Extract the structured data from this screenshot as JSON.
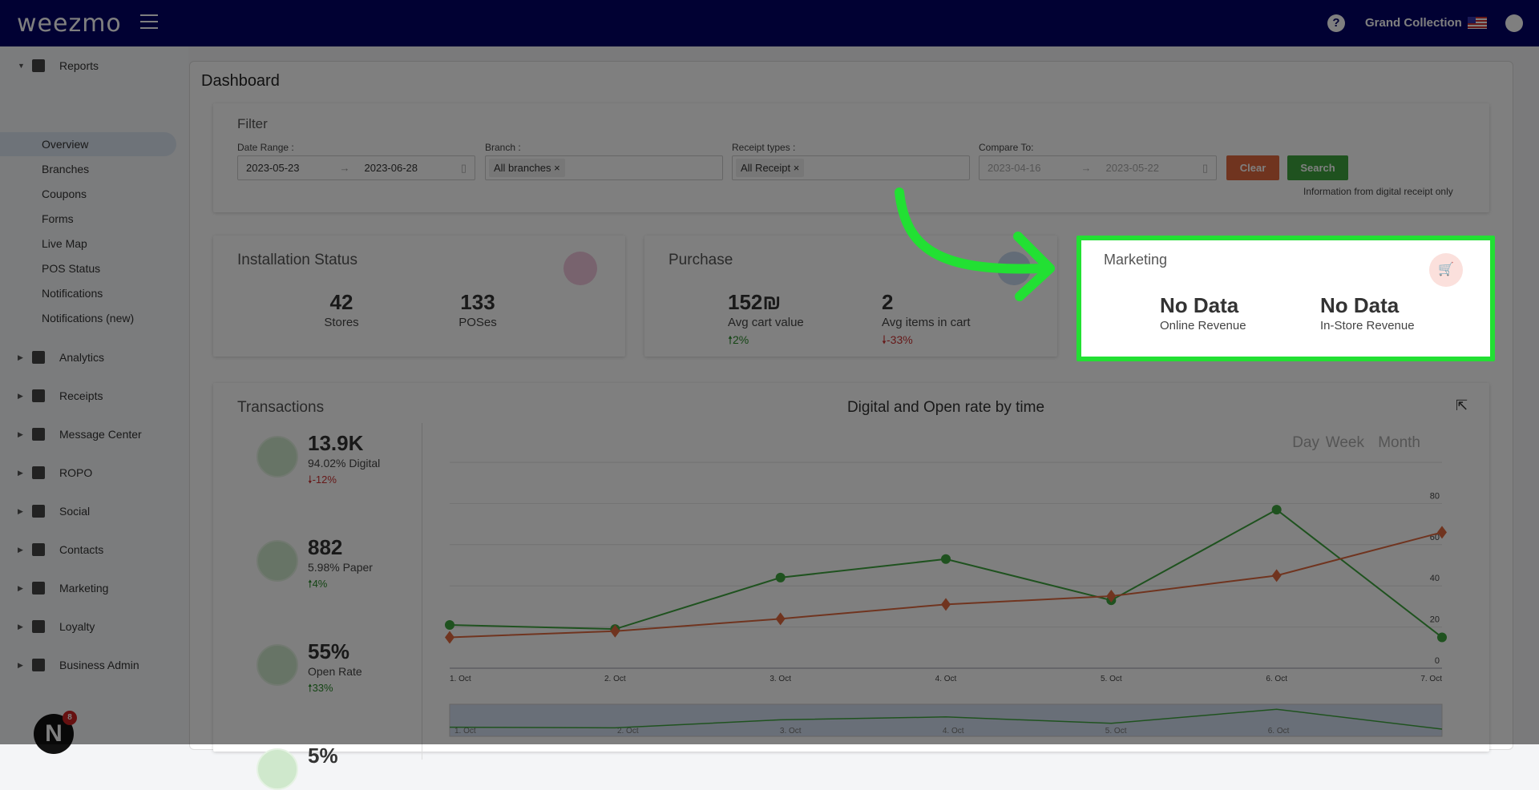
{
  "header": {
    "logo": "weezmo",
    "store": "Grand Collection"
  },
  "sidebar": {
    "section": "Reports",
    "items": [
      "Overview",
      "Branches",
      "Coupons",
      "Forms",
      "Live Map",
      "POS Status",
      "Notifications",
      "Notifications (new)"
    ],
    "groups": [
      "Analytics",
      "Receipts",
      "Message Center",
      "ROPO",
      "Social",
      "Contacts",
      "Marketing",
      "Loyalty",
      "Business Admin"
    ],
    "badge": "8",
    "badge_letter": "N"
  },
  "page": {
    "title": "Dashboard"
  },
  "filter": {
    "title": "Filter",
    "date_label": "Date Range :",
    "date_from": "2023-05-23",
    "date_to": "2023-06-28",
    "branch_label": "Branch :",
    "branch_tag": "All branches",
    "receipt_label": "Receipt types :",
    "receipt_tag": "All Receipt",
    "compare_label": "Compare To:",
    "compare_from": "2023-04-16",
    "compare_to": "2023-05-22",
    "clear": "Clear",
    "search": "Search",
    "note": "Information from digital receipt only",
    "remove": "×",
    "arrow": "→"
  },
  "installation": {
    "title": "Installation Status",
    "stores": "42",
    "stores_label": "Stores",
    "poses": "133",
    "poses_label": "POSes"
  },
  "purchase": {
    "title": "Purchase",
    "avg_cart": "152₪",
    "avg_cart_label": "Avg cart value",
    "avg_cart_change": "🠕2%",
    "avg_items": "2",
    "avg_items_label": "Avg items in cart",
    "avg_items_change": "🠗-33%"
  },
  "marketing": {
    "title": "Marketing",
    "online": "No Data",
    "online_label": "Online Revenue",
    "instore": "No Data",
    "instore_label": "In-Store Revenue"
  },
  "transactions": {
    "title": "Transactions",
    "stats": [
      {
        "value": "13.9K",
        "desc": "94.02% Digital",
        "change": "🠗-12%",
        "trend": "down"
      },
      {
        "value": "882",
        "desc": "5.98% Paper",
        "change": "🠕4%",
        "trend": "up"
      },
      {
        "value": "55%",
        "desc": "Open Rate",
        "change": "🠕33%",
        "trend": "up"
      },
      {
        "value": "5%",
        "desc": "",
        "change": "",
        "trend": ""
      }
    ]
  },
  "chart_data": {
    "type": "line",
    "title": "Digital and Open rate by time",
    "categories": [
      "1. Oct",
      "2. Oct",
      "3. Oct",
      "4. Oct",
      "5. Oct",
      "6. Oct",
      "7. Oct"
    ],
    "series": [
      {
        "values": [
          21,
          19,
          44,
          53,
          33,
          77,
          15
        ],
        "color": "#3fa53f",
        "marker": "circle"
      },
      {
        "values": [
          15,
          18,
          24,
          31,
          35,
          45,
          66
        ],
        "color": "#e0693f",
        "marker": "diamond"
      }
    ],
    "yticks": [
      0,
      20,
      40,
      60,
      80
    ],
    "ylim": [
      0,
      100
    ],
    "periods": [
      "Day",
      "Week",
      "Month"
    ],
    "grid": true,
    "legend": "none"
  },
  "colors": {
    "highlight": "#22e033",
    "clear": "#e0693f",
    "search": "#3fa53f"
  }
}
